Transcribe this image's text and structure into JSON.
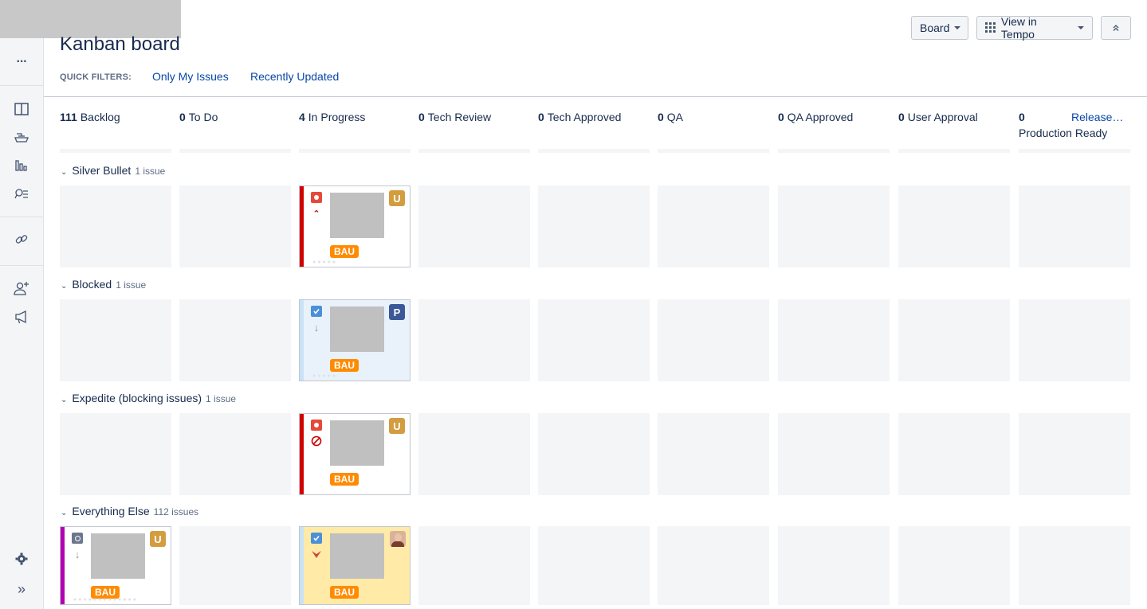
{
  "board": {
    "title": "Kanban board",
    "quick_filters_label": "QUICK FILTERS:",
    "quick_filters": [
      "Only My Issues",
      "Recently Updated"
    ],
    "buttons": {
      "board": "Board",
      "tempo": "View in Tempo",
      "collapse": "⌃⌃"
    }
  },
  "sidebar": {
    "icons": [
      "more-icon",
      "board-icon",
      "releases-icon",
      "reports-icon",
      "issues-search-icon",
      "link-icon",
      "add-people-icon",
      "announce-icon",
      "settings-icon",
      "expand-icon"
    ],
    "expand_glyph": "»",
    "more_glyph": "···"
  },
  "columns": [
    {
      "count": "111",
      "name": "Backlog"
    },
    {
      "count": "0",
      "name": "To Do"
    },
    {
      "count": "4",
      "name": "In Progress"
    },
    {
      "count": "0",
      "name": "Tech Review"
    },
    {
      "count": "0",
      "name": "Tech Approved"
    },
    {
      "count": "0",
      "name": "QA"
    },
    {
      "count": "0",
      "name": "QA Approved"
    },
    {
      "count": "0",
      "name": "User Approval"
    },
    {
      "count": "0",
      "name": "Production Ready",
      "link": "Release…"
    }
  ],
  "swimlanes": [
    {
      "name": "Silver Bullet",
      "count": "1 issue"
    },
    {
      "name": "Blocked",
      "count": "1 issue"
    },
    {
      "name": "Expedite (blocking issues)",
      "count": "1 issue"
    },
    {
      "name": "Everything Else",
      "count": "112 issues"
    }
  ],
  "cards": [
    {
      "badge": "U",
      "epic": "BAU",
      "stripe": "#d04437",
      "type": "bug",
      "priority": "highest",
      "badge_color": "#d39c3f"
    },
    {
      "badge": "P",
      "epic": "BAU",
      "stripe": "#c9e2f7",
      "type": "task",
      "priority": "low",
      "badge_color": "#3b5998"
    },
    {
      "badge": "U",
      "epic": "BAU",
      "stripe": "#d04437",
      "type": "bug",
      "priority": "blocker",
      "badge_color": "#d39c3f"
    },
    {
      "badge": "U",
      "epic": "BAU",
      "stripe": "#b300b3",
      "type": "story",
      "priority": "low",
      "badge_color": "#d39c3f"
    },
    {
      "badge": "",
      "epic": "BAU",
      "stripe": "#c9e2f7",
      "type": "task",
      "priority": "lowest",
      "badge_color": ""
    }
  ]
}
